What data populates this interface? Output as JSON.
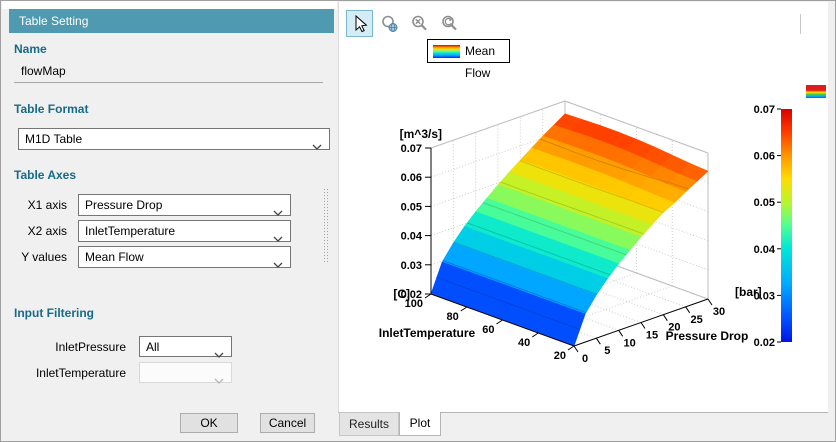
{
  "colors": {
    "header_teal": "#4f9ab0",
    "section_label": "#176b87",
    "toolbar_selected_bg": "#d5ecf5",
    "toolbar_selected_border": "#79b7cd",
    "surface_colormap": "jet"
  },
  "left_panel": {
    "title": "Table Setting",
    "name_label": "Name",
    "name_value": "flowMap",
    "table_format_label": "Table Format",
    "table_format_value": "M1D Table",
    "table_axes_label": "Table Axes",
    "axes_rows": [
      {
        "label": "X1 axis",
        "value": "Pressure Drop"
      },
      {
        "label": "X2 axis",
        "value": "InletTemperature"
      },
      {
        "label": "Y values",
        "value": "Mean Flow"
      }
    ],
    "input_filtering_label": "Input Filtering",
    "filter_rows": [
      {
        "label": "InletPressure",
        "value": "All",
        "enabled": true
      },
      {
        "label": "InletTemperature",
        "value": "",
        "enabled": false
      }
    ],
    "ok_label": "OK",
    "cancel_label": "Cancel"
  },
  "toolbar": {
    "icons": [
      "cursor-icon",
      "zoom-fit-icon",
      "zoom-box-icon",
      "zoom-reset-icon",
      "marker-icon",
      "crosshair-marker-icon",
      "double-marker-icon"
    ],
    "selected": "cursor-icon"
  },
  "legend": {
    "label": "Mean Flow",
    "swatch": "rainbow-gradient"
  },
  "tabs": [
    {
      "label": "Results",
      "active": false
    },
    {
      "label": "Plot",
      "active": true
    }
  ],
  "chart_data": {
    "type": "surface",
    "series_name": "Mean Flow",
    "grid": true,
    "x": {
      "label": "Pressure Drop",
      "unit": "[bar]",
      "range": [
        0,
        30
      ],
      "ticks": [
        0,
        5,
        10,
        15,
        20,
        25,
        30
      ],
      "values": [
        0,
        2.5,
        5,
        7.5,
        10,
        12.5,
        15,
        17.5,
        20,
        22.5,
        25,
        27.5,
        30
      ]
    },
    "y": {
      "label": "InletTemperature",
      "unit": "[C]",
      "range": [
        20,
        100
      ],
      "ticks": [
        100,
        80,
        60,
        40,
        20
      ],
      "values": [
        20,
        30,
        40,
        50,
        60,
        70,
        80,
        90,
        100
      ]
    },
    "z": {
      "label": "Mean Flow",
      "unit": "[m^3/s]",
      "range": [
        0.02,
        0.07
      ],
      "ticks": [
        0.07,
        0.06,
        0.05,
        0.04,
        0.03,
        0.02
      ]
    },
    "z_grid": [
      [
        0.02,
        0.0296,
        0.0348,
        0.0391,
        0.0428,
        0.0461,
        0.0493,
        0.0522,
        0.055,
        0.057,
        0.0594,
        0.0616,
        0.0638
      ],
      [
        0.02,
        0.0296,
        0.0348,
        0.0391,
        0.0428,
        0.0461,
        0.0493,
        0.0522,
        0.055,
        0.0572,
        0.0596,
        0.0619,
        0.0642
      ],
      [
        0.02,
        0.0296,
        0.0348,
        0.0391,
        0.0428,
        0.0461,
        0.0493,
        0.0522,
        0.055,
        0.0575,
        0.0601,
        0.0624,
        0.0648
      ],
      [
        0.02,
        0.0296,
        0.0348,
        0.0391,
        0.0428,
        0.0461,
        0.0493,
        0.0522,
        0.0551,
        0.0578,
        0.0605,
        0.0629,
        0.0654
      ],
      [
        0.02,
        0.0296,
        0.0348,
        0.0391,
        0.0428,
        0.0461,
        0.0493,
        0.0523,
        0.0552,
        0.058,
        0.0608,
        0.0633,
        0.0658
      ],
      [
        0.02,
        0.0296,
        0.0348,
        0.0391,
        0.0428,
        0.0461,
        0.0494,
        0.0523,
        0.0552,
        0.0581,
        0.0609,
        0.0635,
        0.066
      ],
      [
        0.02,
        0.0296,
        0.0348,
        0.0391,
        0.0428,
        0.0461,
        0.0494,
        0.0523,
        0.0552,
        0.0581,
        0.0609,
        0.0635,
        0.066
      ],
      [
        0.02,
        0.0296,
        0.0348,
        0.0391,
        0.0428,
        0.0461,
        0.0494,
        0.0523,
        0.0552,
        0.058,
        0.0608,
        0.0633,
        0.0658
      ],
      [
        0.02,
        0.0296,
        0.0348,
        0.0391,
        0.0428,
        0.0461,
        0.0493,
        0.0523,
        0.0551,
        0.0579,
        0.0606,
        0.0631,
        0.0656
      ]
    ],
    "contour_levels": [
      0.025,
      0.03,
      0.035,
      0.04,
      0.045,
      0.05,
      0.055,
      0.06
    ],
    "colorbar": {
      "min": 0.02,
      "max": 0.07,
      "ticks": [
        0.07,
        0.06,
        0.05,
        0.04,
        0.03,
        0.02
      ],
      "colormap": "jet",
      "position": "right"
    }
  }
}
